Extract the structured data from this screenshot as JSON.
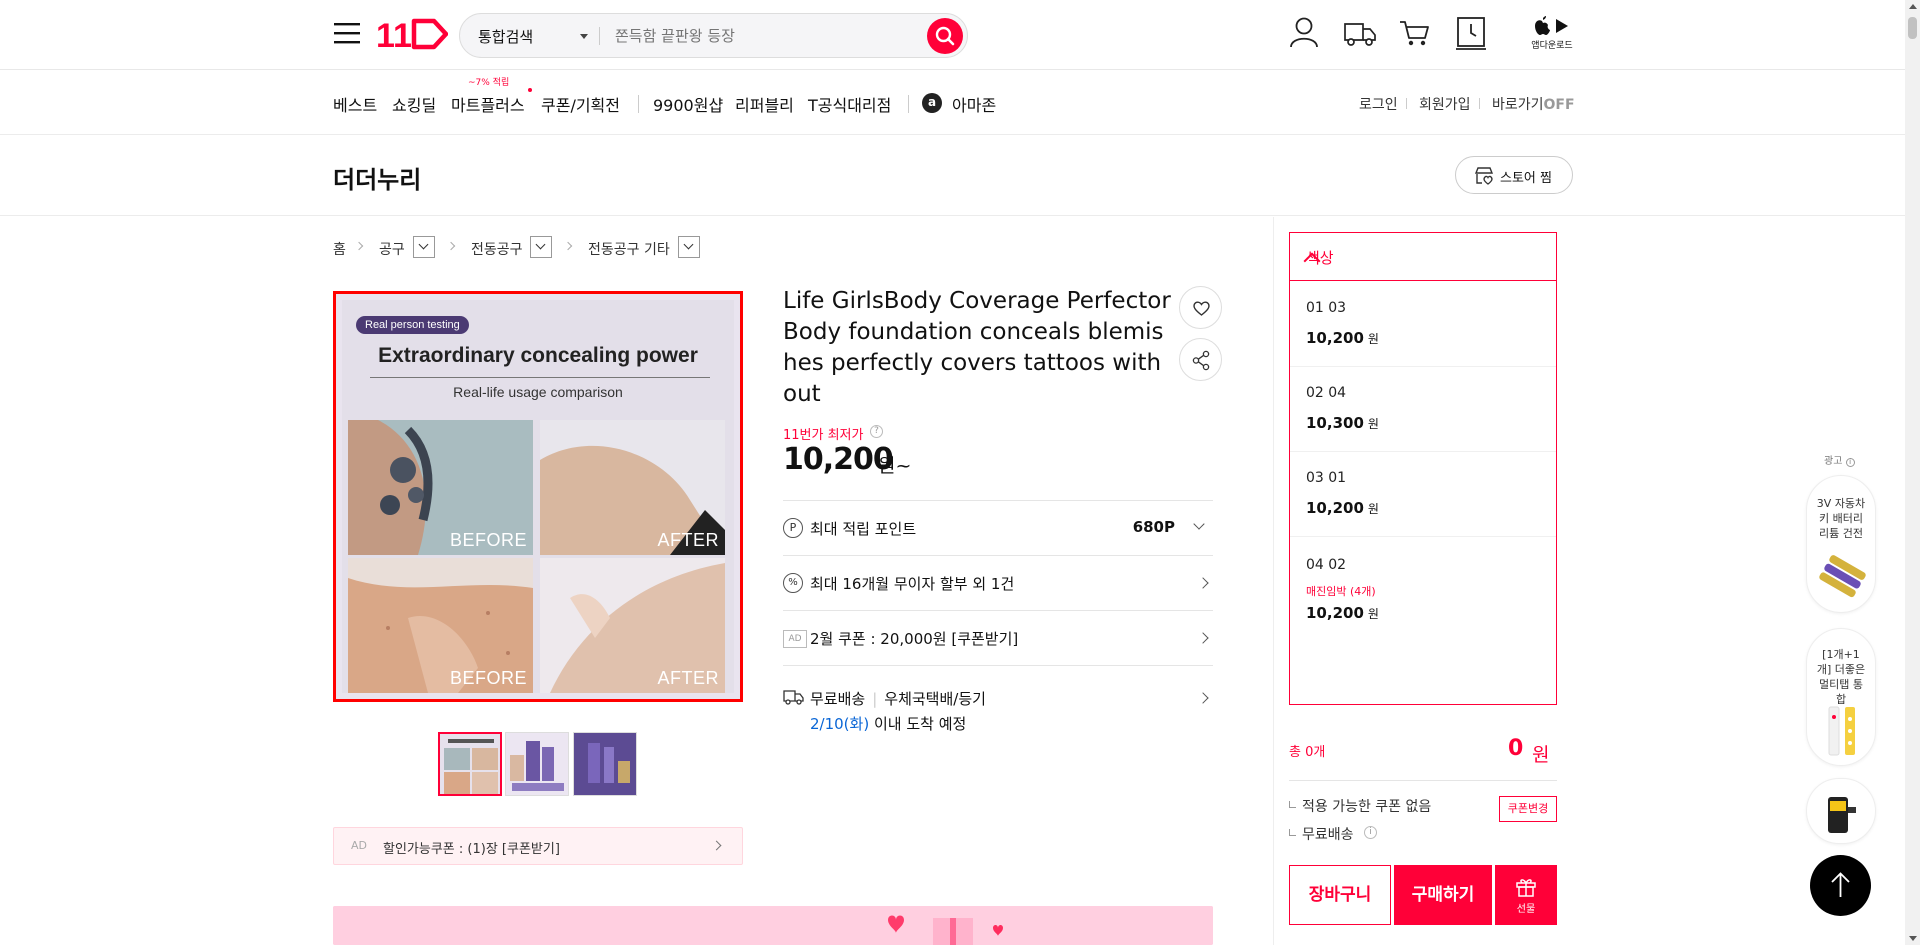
{
  "header": {
    "logo": "11",
    "search_scope": "통합검색",
    "search_placeholder": "쫀득함 끝판왕 등장",
    "app_download": "앱다운로드"
  },
  "gnb": {
    "items": [
      "베스트",
      "쇼킹딜",
      "마트플러스",
      "쿠폰/기획전",
      "9900원샵",
      "리퍼블리",
      "T공식대리점",
      "아마존"
    ],
    "mart_badge": "~7% 적립",
    "amazon_icon_letter": "a",
    "util": {
      "login": "로그인",
      "join": "회원가입",
      "shortcut": "바로가기",
      "shortcut_state": "OFF"
    }
  },
  "store": {
    "name": "더더누리",
    "favorite_label": "스토어 찜"
  },
  "breadcrumb": [
    "홈",
    "공구",
    "전동공구",
    "전동공구 기타"
  ],
  "product": {
    "image": {
      "tag": "Real person testing",
      "title": "Extraordinary concealing power",
      "subtitle": "Real-life usage comparison",
      "labels": [
        "BEFORE",
        "AFTER",
        "BEFORE",
        "AFTER"
      ]
    },
    "title": "Life GirlsBody Coverage Perfector Body foundation conceals blemishes perfectly covers tattoos without",
    "lowest_label": "11번가 최저가",
    "price": "10,200",
    "price_unit": "원~",
    "points_label": "최대 적립 포인트",
    "points_value": "680P",
    "installment": "최대 16개월 무이자 할부 외 1건",
    "ad_tag": "AD",
    "coupon_row": "2월 쿠폰 : 20,000원 [쿠폰받기]",
    "shipping_free": "무료배송",
    "shipping_method": "우체국택배/등기",
    "arrival_date": "2/10(화)",
    "arrival_text": "이내 도착 예정",
    "discount_coupon": "할인가능쿠폰 : (1)장 [쿠폰받기]"
  },
  "options": {
    "header": "색상",
    "items": [
      {
        "name": "01 03",
        "price": "10,200",
        "unit": "원",
        "warn": ""
      },
      {
        "name": "02 04",
        "price": "10,300",
        "unit": "원",
        "warn": ""
      },
      {
        "name": "03 01",
        "price": "10,200",
        "unit": "원",
        "warn": ""
      },
      {
        "name": "04 02",
        "price": "10,200",
        "unit": "원",
        "warn": "매진임박 (4개)"
      }
    ]
  },
  "summary": {
    "total_label": "총 0개",
    "total_value": "0",
    "total_unit": "원",
    "no_coupon": "적용 가능한 쿠폰 없음",
    "free_ship": "무료배송",
    "coupon_change": "쿠폰변경",
    "cart": "장바구니",
    "buy": "구매하기",
    "gift": "선물"
  },
  "ads": {
    "label": "광고",
    "cards": [
      "3V 자동차 키 배터리 리튬 건전",
      "[1개+1개] 더좋은 멀티탭 통합"
    ]
  },
  "colors": {
    "accent": "#ff0038",
    "link_blue": "#0a66d6"
  }
}
